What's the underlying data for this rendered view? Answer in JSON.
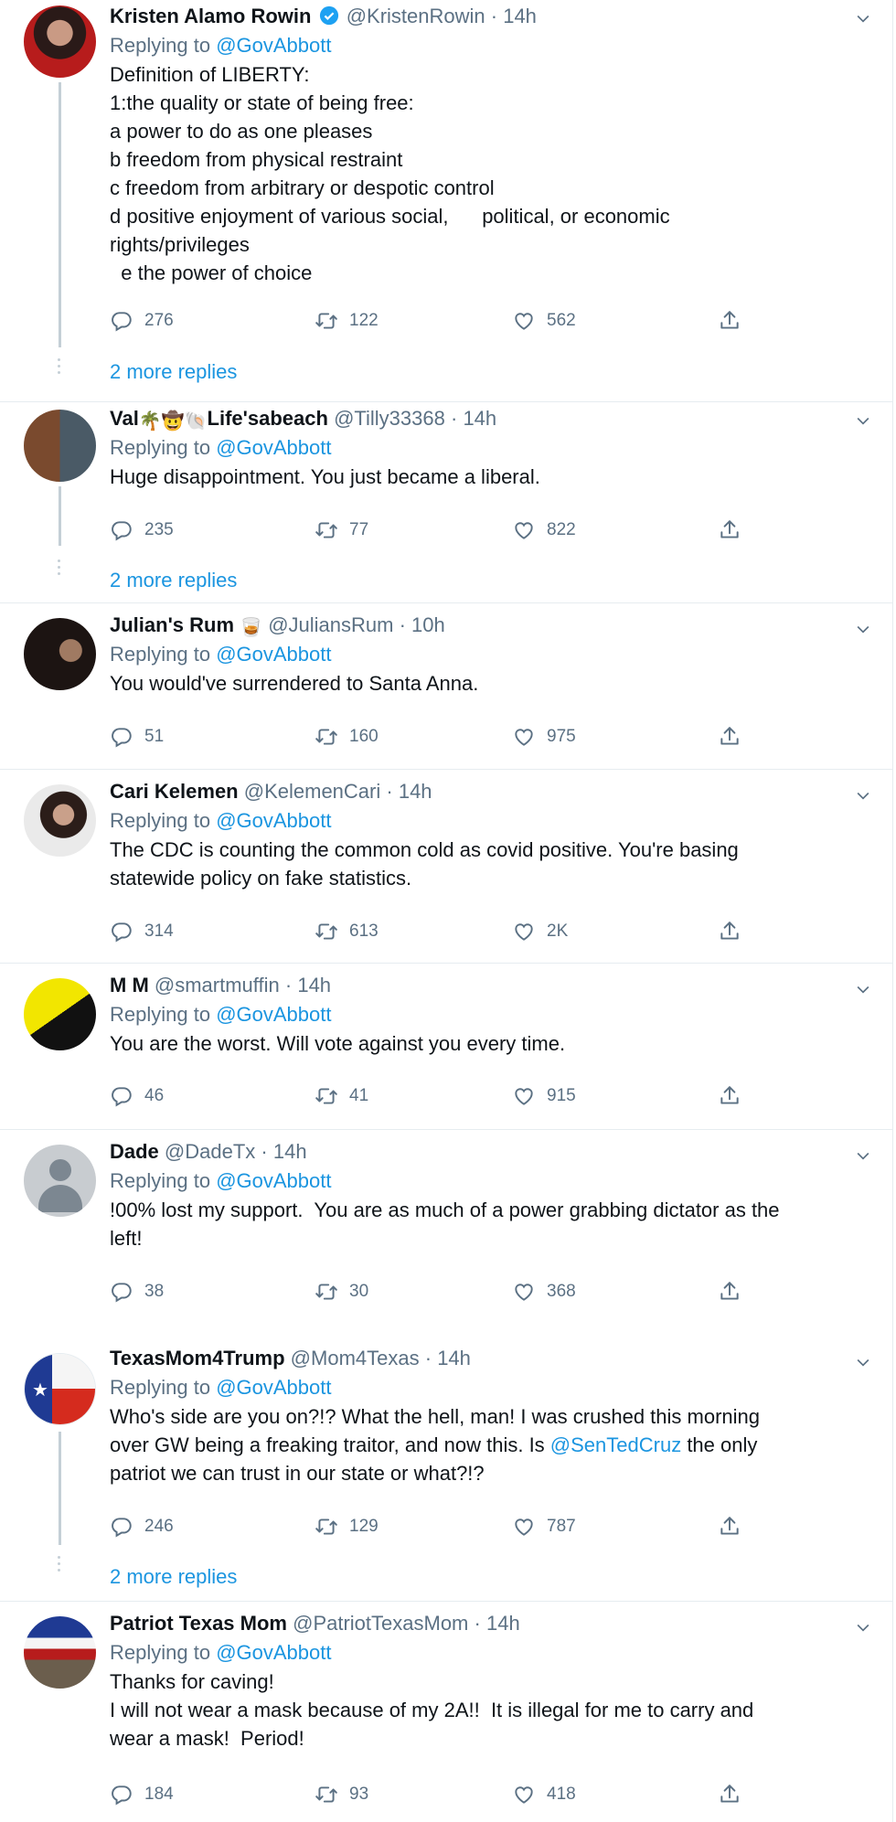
{
  "tweets": [
    {
      "name": "Kristen Alamo Rowin",
      "handle": "@KristenRowin",
      "time": "14h",
      "replying_label": "Replying to",
      "replying_to": "@GovAbbott",
      "lines": [
        "Definition of LIBERTY:",
        "1:the quality or state of being free:",
        "a power to do as one pleases",
        "b freedom from physical restraint",
        "c freedom from arbitrary or despotic control",
        "d positive enjoyment of various social,      political, or economic",
        "rights/privileges",
        "  e the power of choice"
      ],
      "replies": "276",
      "retweets": "122",
      "likes": "562",
      "more_replies": "2 more replies"
    },
    {
      "name": "Val",
      "name_suffix": "Life'sabeach",
      "handle": "@Tilly33368",
      "time": "14h",
      "replying_label": "Replying to",
      "replying_to": "@GovAbbott",
      "lines": [
        "Huge disappointment. You just became a liberal."
      ],
      "replies": "235",
      "retweets": "77",
      "likes": "822",
      "more_replies": "2 more replies"
    },
    {
      "name": "Julian's Rum",
      "handle": "@JuliansRum",
      "time": "10h",
      "replying_label": "Replying to",
      "replying_to": "@GovAbbott",
      "lines": [
        "You would've surrendered to Santa Anna."
      ],
      "replies": "51",
      "retweets": "160",
      "likes": "975"
    },
    {
      "name": "Cari Kelemen",
      "handle": "@KelemenCari",
      "time": "14h",
      "replying_label": "Replying to",
      "replying_to": "@GovAbbott",
      "lines": [
        "The CDC is counting the common cold as covid positive. You're basing",
        "statewide policy on fake statistics."
      ],
      "replies": "314",
      "retweets": "613",
      "likes": "2K"
    },
    {
      "name": "M M",
      "handle": "@smartmuffin",
      "time": "14h",
      "replying_label": "Replying to",
      "replying_to": "@GovAbbott",
      "lines": [
        "You are the worst. Will vote against you every time."
      ],
      "replies": "46",
      "retweets": "41",
      "likes": "915"
    },
    {
      "name": "Dade",
      "handle": "@DadeTx",
      "time": "14h",
      "replying_label": "Replying to",
      "replying_to": "@GovAbbott",
      "lines": [
        "!00% lost my support.  You are as much of a power grabbing dictator as the",
        "left!"
      ],
      "replies": "38",
      "retweets": "30",
      "likes": "368"
    },
    {
      "name": "TexasMom4Trump",
      "handle": "@Mom4Texas",
      "time": "14h",
      "replying_label": "Replying to",
      "replying_to": "@GovAbbott",
      "lines": [
        "Who's side are you on?!? What the hell, man! I was crushed this morning",
        "over GW being a freaking traitor, and now this. Is ",
        " the only",
        "patriot we can trust in our state or what?!?"
      ],
      "mention_in_body": "@SenTedCruz",
      "replies": "246",
      "retweets": "129",
      "likes": "787",
      "more_replies": "2 more replies"
    },
    {
      "name": "Patriot Texas Mom",
      "handle": "@PatriotTexasMom",
      "time": "14h",
      "replying_label": "Replying to",
      "replying_to": "@GovAbbott",
      "lines": [
        "Thanks for caving!",
        "I will not wear a mask because of my 2A!!  It is illegal for me to carry and",
        "wear a mask!  Period!"
      ],
      "replies": "184",
      "retweets": "93",
      "likes": "418"
    }
  ],
  "separator": "·",
  "colors": {
    "accent": "#1b95e0",
    "muted": "#5b7083",
    "text": "#0f1419",
    "verified": "#1da1f2"
  }
}
